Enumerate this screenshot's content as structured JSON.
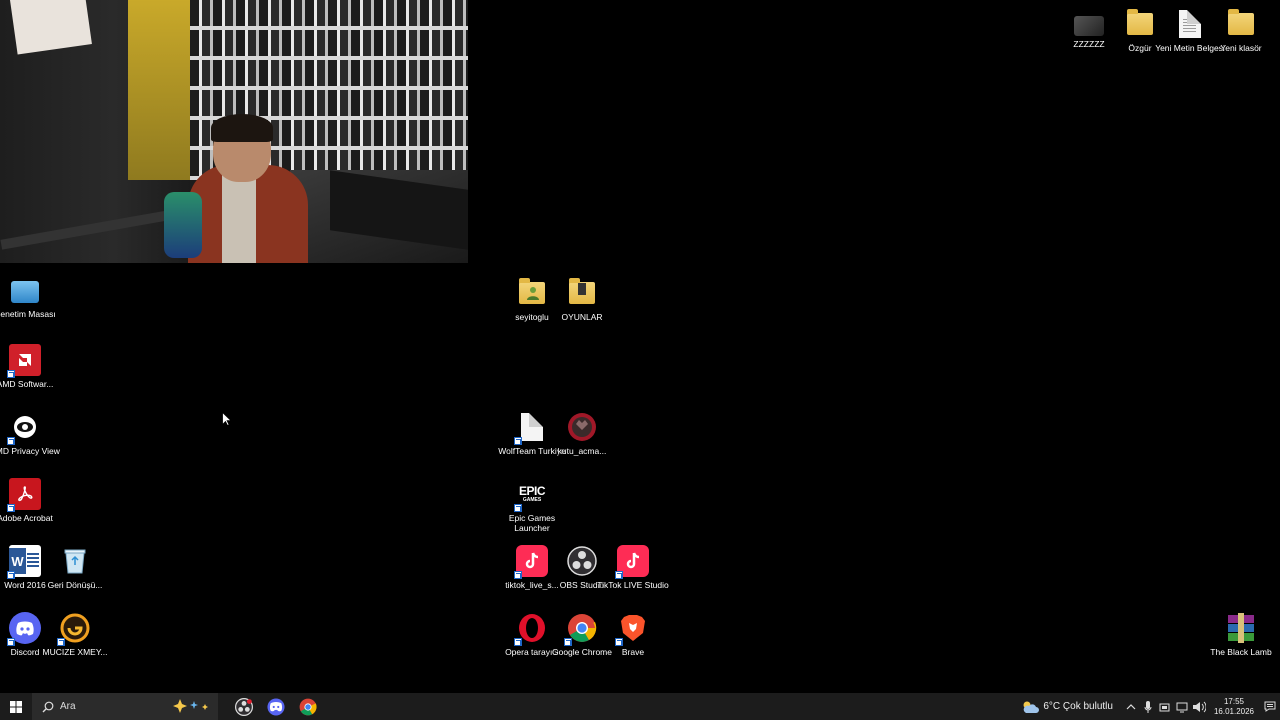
{
  "desktop": {
    "top_right_icons": [
      {
        "label": "ZZZZZZ",
        "icon": "image-thumbnail-icon"
      },
      {
        "label": "Özgür",
        "icon": "folder-icon"
      },
      {
        "label": "Yeni Metin Belgesi",
        "icon": "text-document-icon"
      },
      {
        "label": "Yeni klasör",
        "icon": "folder-icon"
      }
    ],
    "left_icons": [
      {
        "label": "Denetim Masası",
        "icon": "control-panel-icon"
      },
      {
        "label": "AMD Softwar...",
        "icon": "amd-software-icon"
      },
      {
        "label": "AMD Privacy View",
        "icon": "amd-privacy-view-icon"
      },
      {
        "label": "Adobe Acrobat",
        "icon": "adobe-acrobat-icon"
      },
      {
        "label": "Word 2016",
        "icon": "word-icon"
      },
      {
        "label": "Geri Dönüşü...",
        "icon": "recycle-bin-icon"
      },
      {
        "label": "Discord",
        "icon": "discord-icon"
      },
      {
        "label": "MUCIZE XMEY...",
        "icon": "mucize-app-icon"
      }
    ],
    "middle_icons": [
      {
        "label": "seyitoglu",
        "icon": "user-folder-icon"
      },
      {
        "label": "OYUNLAR",
        "icon": "folder-icon"
      },
      {
        "label": "WolfTeam Turkiye",
        "icon": "document-shortcut-icon"
      },
      {
        "label": "kutu_acma...",
        "icon": "video-thumbnail-icon"
      },
      {
        "label": "Epic Games Launcher",
        "icon": "epic-games-icon",
        "glyph": "EPIC",
        "glyph_sub": "GAMES"
      },
      {
        "label": "tiktok_live_s...",
        "icon": "tiktok-live-icon"
      },
      {
        "label": "OBS Studio",
        "icon": "obs-studio-icon"
      },
      {
        "label": "TikTok LIVE Studio",
        "icon": "tiktok-live-studio-icon"
      },
      {
        "label": "Opera tarayıcı",
        "icon": "opera-icon"
      },
      {
        "label": "Google Chrome",
        "icon": "chrome-icon"
      },
      {
        "label": "Brave",
        "icon": "brave-icon"
      }
    ],
    "bottom_right_icon": {
      "label": "The Black Lamb",
      "icon": "rar-archive-icon"
    }
  },
  "taskbar": {
    "search_placeholder": "Ara",
    "apps": [
      {
        "name": "obs-taskbar-icon"
      },
      {
        "name": "discord-taskbar-icon"
      },
      {
        "name": "chrome-taskbar-icon"
      }
    ],
    "weather": "6°C  Çok bulutlu",
    "time": "17:55",
    "date": "16.01.2026"
  },
  "colors": {
    "taskbar_bg": "#1c1c1c",
    "search_bg": "#2b2b2b",
    "desktop_bg": "#000000"
  }
}
